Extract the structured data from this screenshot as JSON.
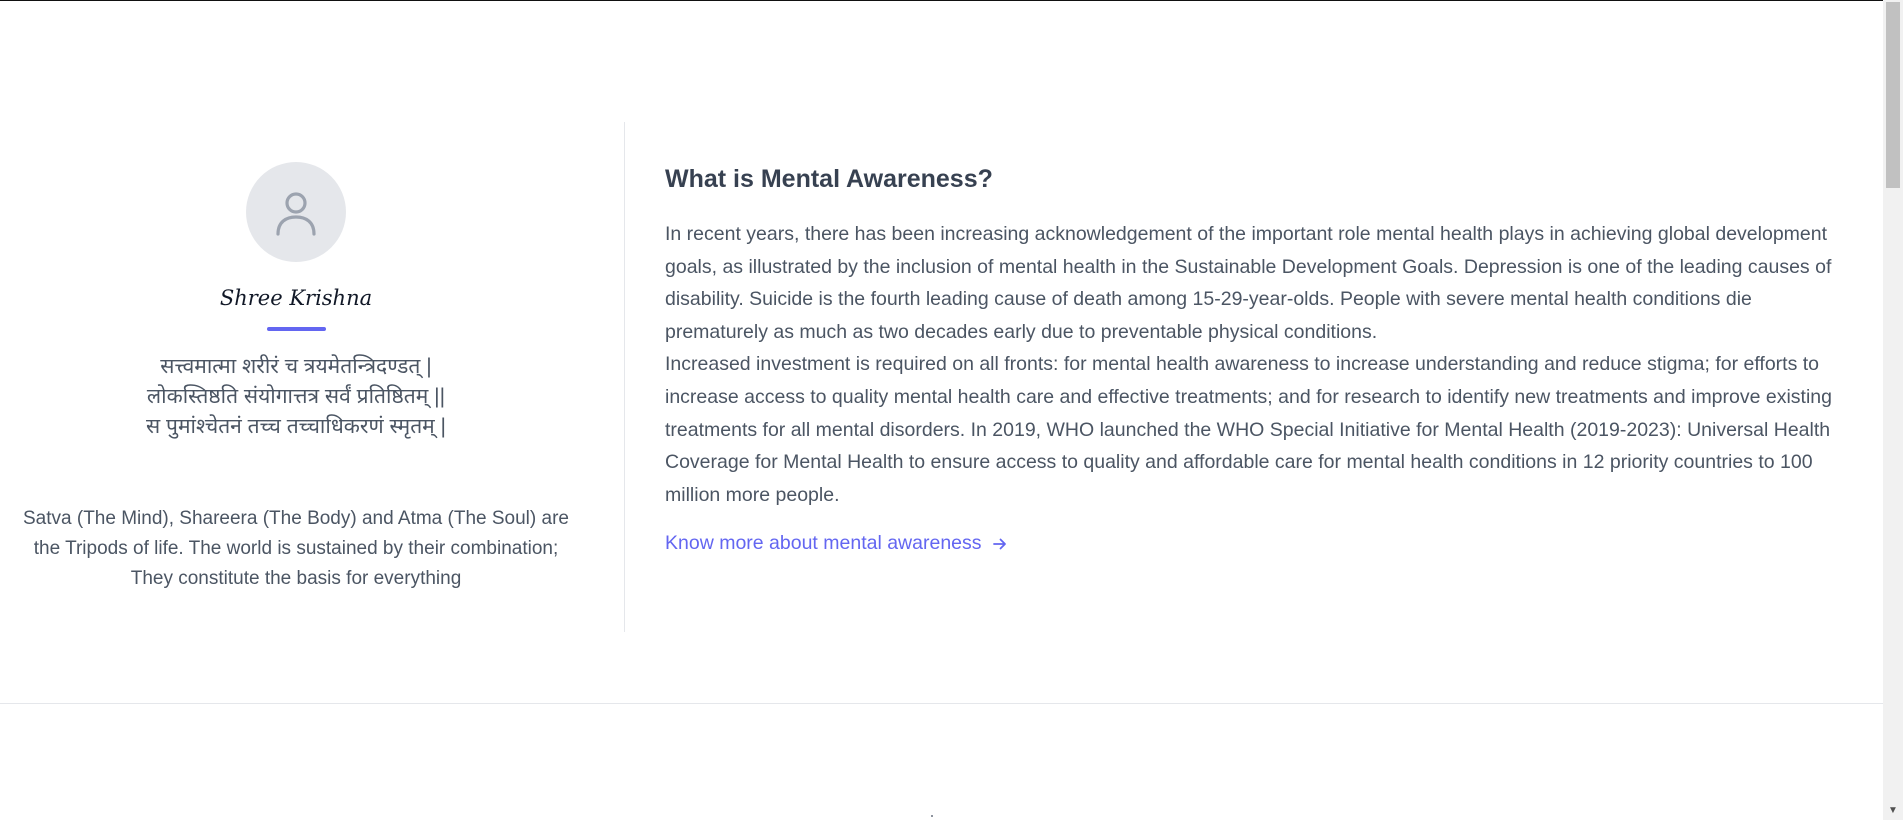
{
  "profile": {
    "name": "Shree Krishna",
    "avatar_icon": "user-icon",
    "accent_color": "#6366f1"
  },
  "verse": {
    "lines": [
      "सत्त्वमात्मा शरीरं च त्रयमेतन्त्रिदण्डत् |",
      "लोकस्तिष्ठति संयोगात्तत्र सर्वं प्रतिष्ठितम् ||",
      "स पुमांश्चेतनं तच्च तच्चाधिकरणं स्मृतम् |"
    ]
  },
  "translation": {
    "lines": [
      "Satva (The Mind), Shareera (The Body) and Atma (The Soul) are",
      "the Tripods of life. The world is sustained by their combination;",
      "They constitute the basis for everything"
    ]
  },
  "content": {
    "heading": "What is Mental Awareness?",
    "paragraph_1": "In recent years, there has been increasing acknowledgement of the important role mental health plays in achieving global development goals, as illustrated by the inclusion of mental health in the Sustainable Development Goals. Depression is one of the leading causes of disability. Suicide is the fourth leading cause of death among 15-29-year-olds. People with severe mental health conditions die prematurely as much as two decades early due to preventable physical conditions.",
    "paragraph_2": "Increased investment is required on all fronts: for mental health awareness to increase understanding and reduce stigma; for efforts to increase access to quality mental health care and effective treatments; and for research to identify new treatments and improve existing treatments for all mental disorders. In 2019, WHO launched the WHO Special Initiative for Mental Health (2019-2023): Universal Health Coverage for Mental Health to ensure access to quality and affordable care for mental health conditions in 12 priority countries to 100 million more people.",
    "link_label": "Know more about mental awareness",
    "link_icon": "arrow-right-icon"
  }
}
